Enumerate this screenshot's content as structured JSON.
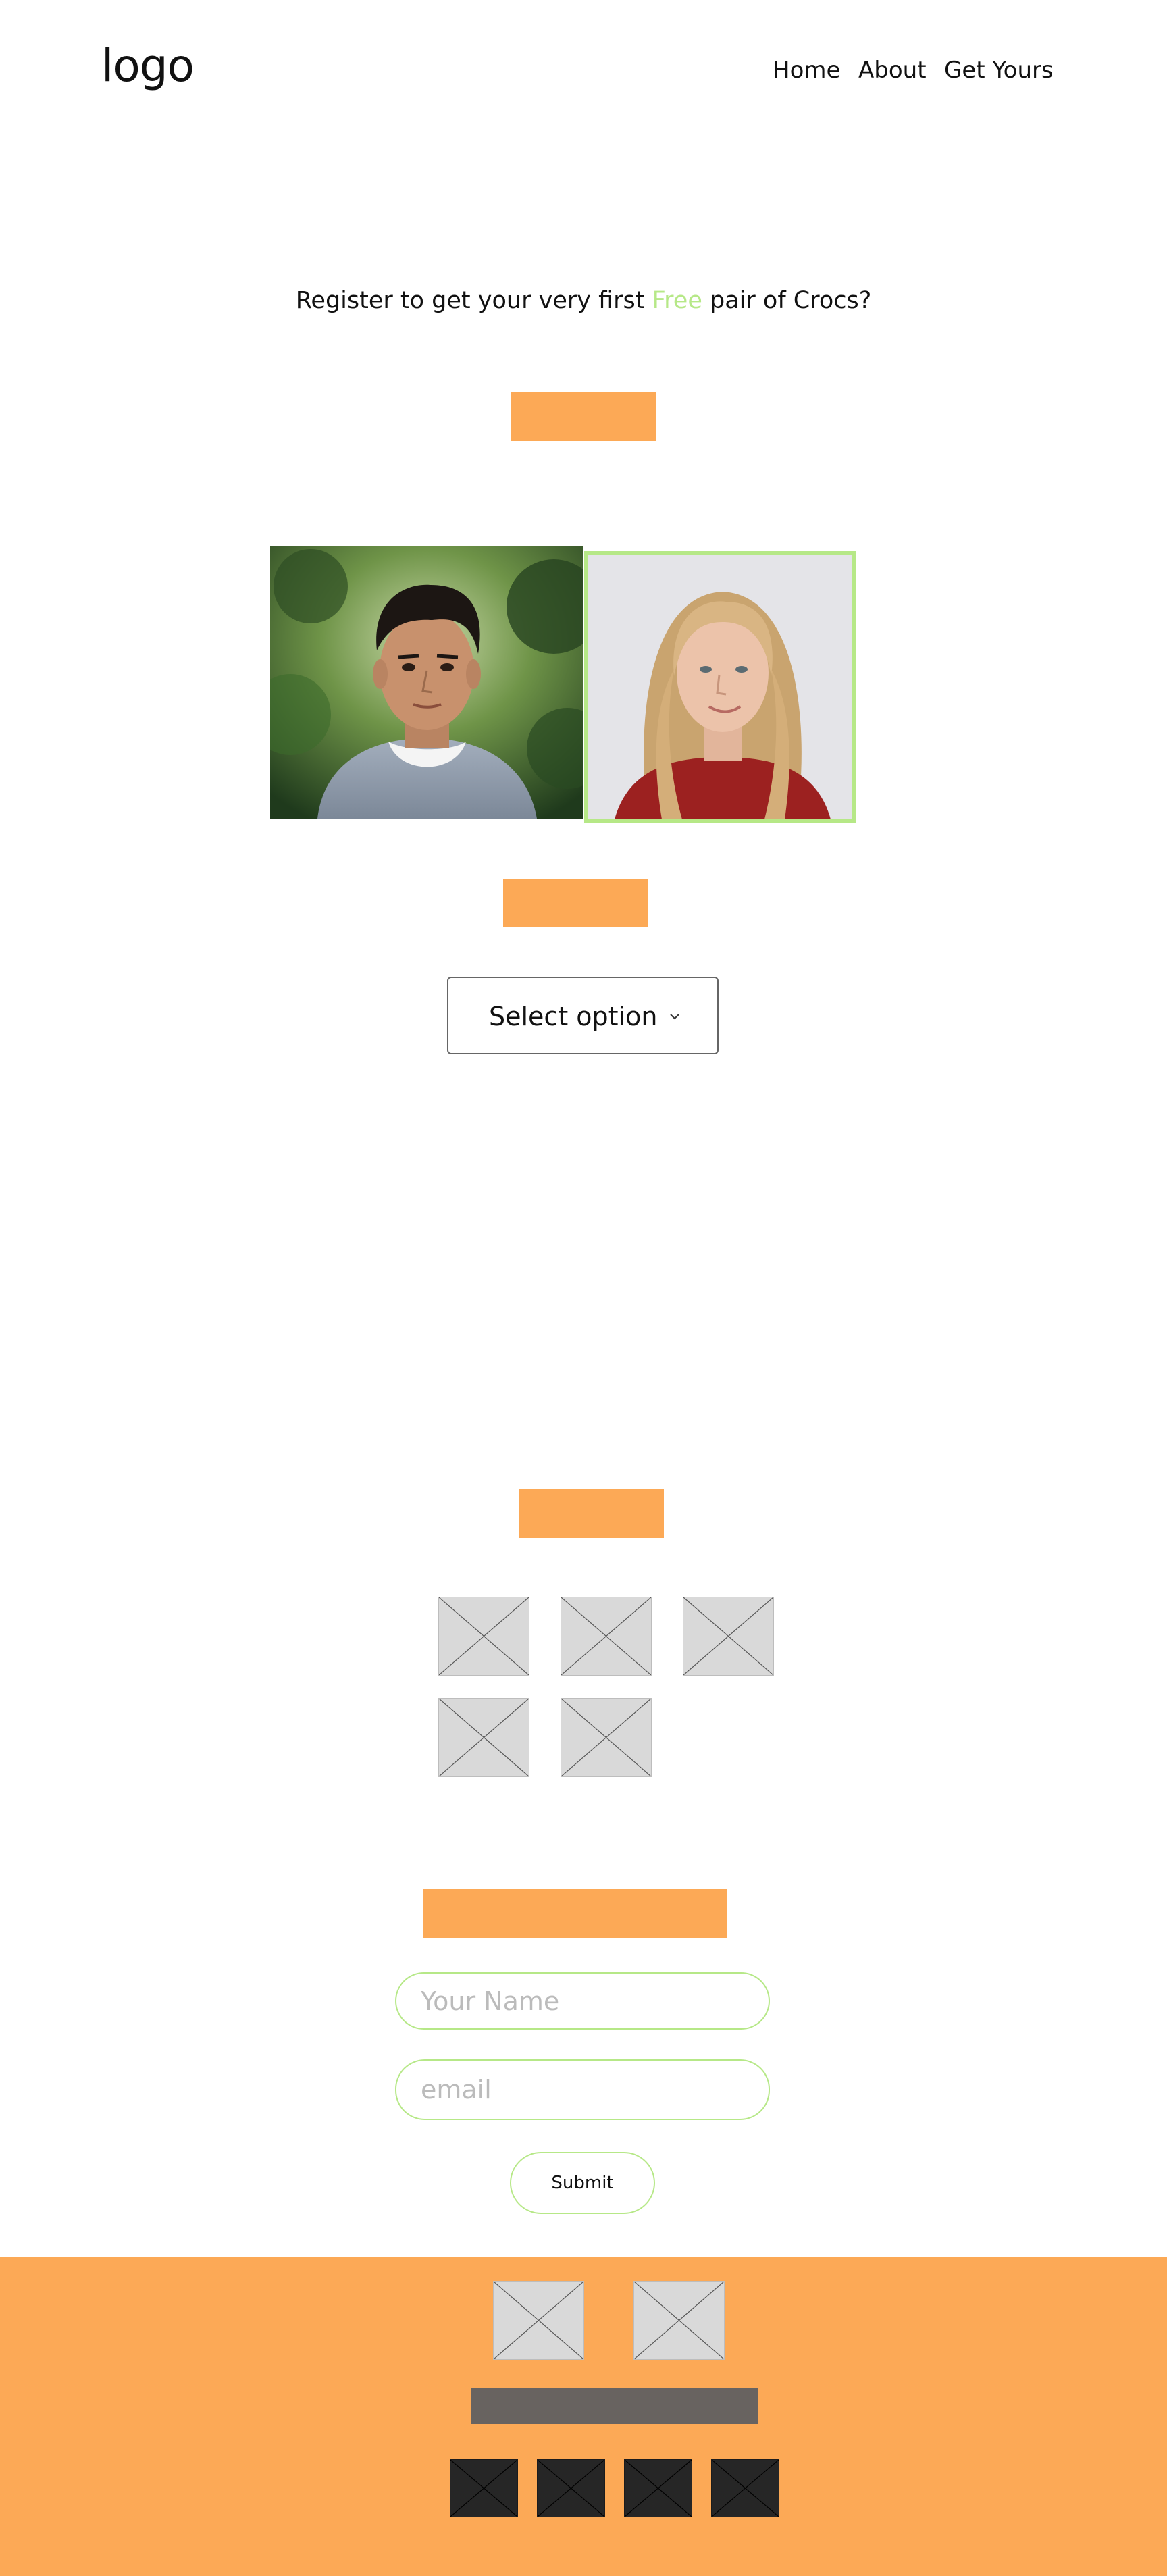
{
  "header": {
    "logo": "logo",
    "nav": {
      "home": "Home",
      "about": "About",
      "get_yours": "Get Yours"
    }
  },
  "hero": {
    "headline_before": "Register to get your very first ",
    "headline_highlight": "Free",
    "headline_after": " pair of Crocs?"
  },
  "select": {
    "label": "Select option"
  },
  "form": {
    "name_placeholder": "Your Name",
    "email_placeholder": "email",
    "submit_label": "Submit"
  },
  "colors": {
    "accent_orange": "#fca956",
    "accent_green": "#b6e887",
    "footer_bar": "#686360",
    "placeholder_gray": "#d9d9d9",
    "placeholder_dark": "#262626"
  },
  "icons": {
    "select_chevron": "chevron-down-icon",
    "image_placeholder": "image-placeholder-icon"
  }
}
